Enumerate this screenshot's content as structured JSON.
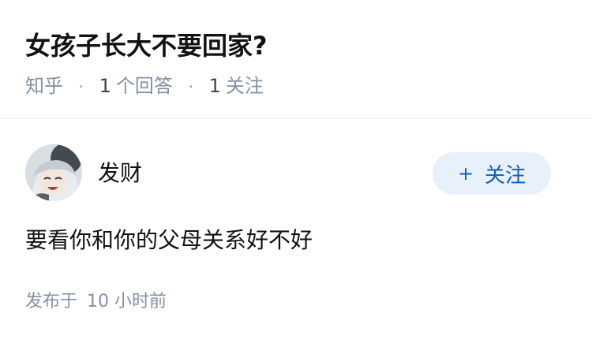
{
  "question": {
    "title": "女孩子长大不要回家?",
    "source": "知乎",
    "answer_count_num": "1",
    "answer_count_label": "个回答",
    "follower_count_num": "1",
    "follower_count_label": "关注"
  },
  "answer": {
    "author_name": "发财",
    "follow_button_label": "关注",
    "follow_icon": "plus-icon",
    "content": "要看你和你的父母关系好不好",
    "published_label": "发布于",
    "published_time": "10 小时前"
  },
  "colors": {
    "meta_gray": "#8590a6",
    "follow_bg": "#e8f1fb",
    "follow_text": "#0a5fbf",
    "divider": "#ebebeb"
  }
}
